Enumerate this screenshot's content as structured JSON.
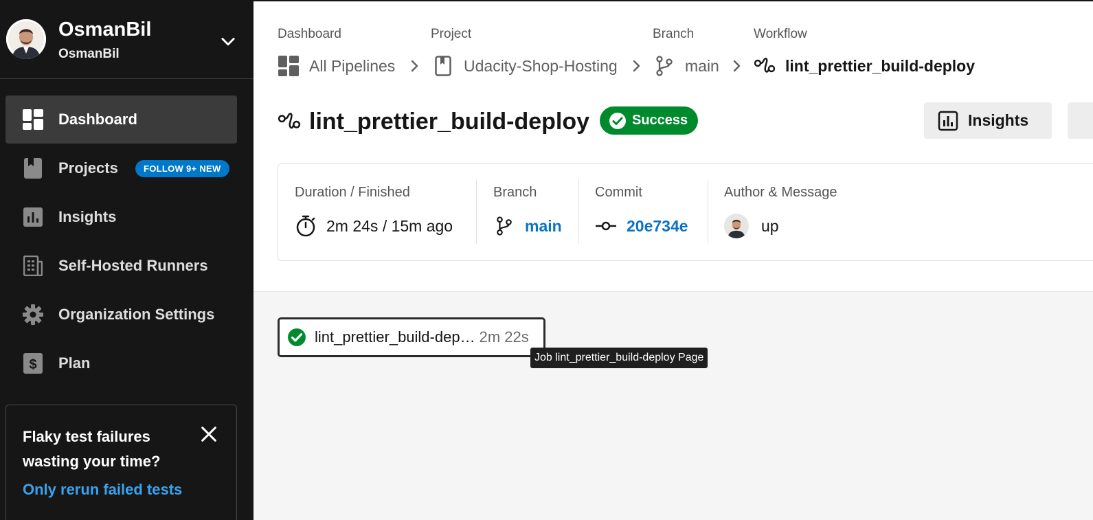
{
  "sidebar": {
    "org_name": "OsmanBil",
    "org_sub": "OsmanBil",
    "nav": [
      {
        "label": "Dashboard",
        "icon": "dashboard-icon"
      },
      {
        "label": "Projects",
        "icon": "bookmark-icon",
        "badge": "FOLLOW 9+ NEW"
      },
      {
        "label": "Insights",
        "icon": "bar-chart-icon"
      },
      {
        "label": "Self-Hosted Runners",
        "icon": "runner-icon"
      },
      {
        "label": "Organization Settings",
        "icon": "gear-icon"
      },
      {
        "label": "Plan",
        "icon": "dollar-icon"
      }
    ],
    "promo": {
      "title": "Flaky test failures wasting your time?",
      "link": "Only rerun failed tests"
    }
  },
  "breadcrumb": {
    "headings": [
      "Dashboard",
      "Project",
      "Branch",
      "Workflow"
    ],
    "items": [
      "All Pipelines",
      "Udacity-Shop-Hosting",
      "main",
      "lint_prettier_build-deploy"
    ]
  },
  "workflow": {
    "title": "lint_prettier_build-deploy",
    "status": "Success",
    "insights_button": "Insights"
  },
  "meta": {
    "duration_heading": "Duration / Finished",
    "duration_value": "2m 24s / 15m ago",
    "branch_heading": "Branch",
    "branch_value": "main",
    "commit_heading": "Commit",
    "commit_value": "20e734e",
    "author_heading": "Author & Message",
    "author_message": "up"
  },
  "job": {
    "name": "lint_prettier_build-dep…",
    "duration": "2m 22s",
    "tooltip": "Job lint_prettier_build-deploy Page"
  },
  "colors": {
    "sidebar_bg": "#161616",
    "success": "#008a2e",
    "link": "#0a72c4",
    "badge": "#0078ca"
  }
}
